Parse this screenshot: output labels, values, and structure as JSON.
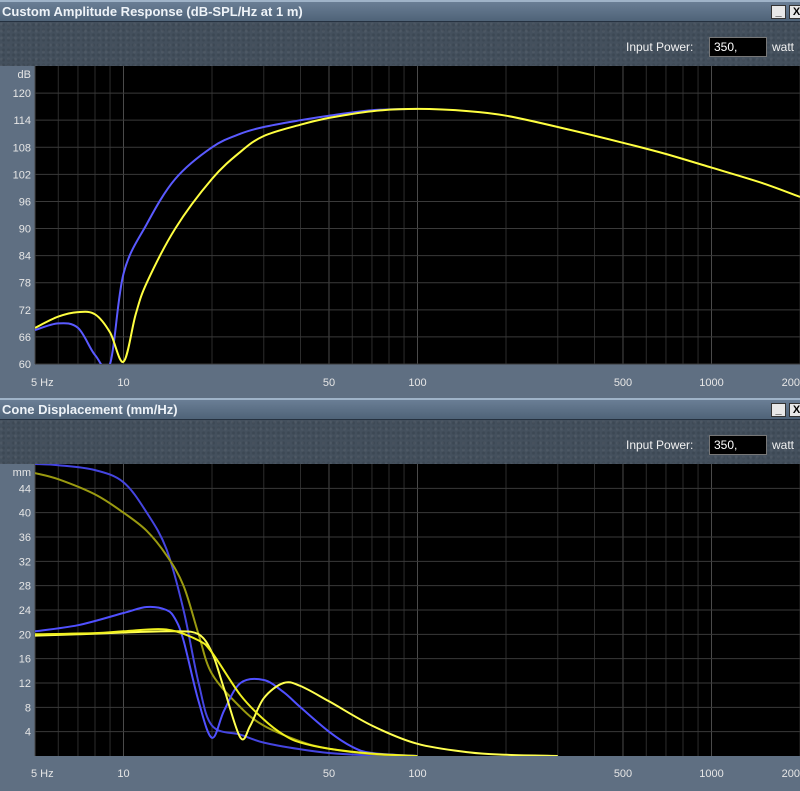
{
  "panels": [
    {
      "title": "Custom Amplitude Response (dB-SPL/Hz at 1 m)",
      "minimize_label": "_",
      "close_label": "X",
      "input_power_label": "Input Power:",
      "input_power_value": "350,",
      "input_power_unit": "watt"
    },
    {
      "title": "Cone Displacement (mm/Hz)",
      "minimize_label": "_",
      "close_label": "X",
      "input_power_label": "Input Power:",
      "input_power_value": "350,",
      "input_power_unit": "watt"
    }
  ],
  "chart_data": [
    {
      "type": "line",
      "title": "Custom Amplitude Response (dB-SPL/Hz at 1 m)",
      "y_unit_label": "dB",
      "x_scale": "log",
      "xlim": [
        5,
        2000
      ],
      "ylim": [
        60,
        126
      ],
      "grid": true,
      "background": "#000000",
      "x_tick_labels": [
        {
          "value": 5,
          "label": "5 Hz"
        },
        {
          "value": 10,
          "label": "10"
        },
        {
          "value": 50,
          "label": "50"
        },
        {
          "value": 100,
          "label": "100"
        },
        {
          "value": 500,
          "label": "500"
        },
        {
          "value": 1000,
          "label": "1000"
        },
        {
          "value": 2000,
          "label": "200"
        }
      ],
      "y_ticks": [
        60,
        66,
        72,
        78,
        84,
        90,
        96,
        102,
        108,
        114,
        120
      ],
      "series": [
        {
          "color": "#5a5aff",
          "x": [
            5,
            6,
            7,
            8,
            9,
            10,
            12,
            15,
            20,
            25,
            30,
            40,
            50,
            70,
            100
          ],
          "y": [
            67.5,
            69,
            68,
            62,
            60,
            80,
            91,
            101,
            108,
            111,
            112.5,
            114,
            115,
            116.2,
            116.5
          ]
        },
        {
          "color": "#ffff40",
          "x": [
            5,
            6,
            7,
            8,
            9,
            10,
            11,
            12,
            15,
            20,
            25,
            30,
            40,
            50,
            70,
            100,
            150,
            200,
            300,
            500,
            700,
            1000,
            1500,
            2000
          ],
          "y": [
            68,
            70.5,
            71.5,
            71,
            67,
            60.5,
            71,
            78,
            90,
            101,
            107,
            110.5,
            113,
            114.5,
            116,
            116.5,
            116,
            115,
            112.5,
            109,
            106.5,
            103.5,
            100,
            97
          ]
        }
      ]
    },
    {
      "type": "line",
      "title": "Cone Displacement (mm/Hz)",
      "y_unit_label": "mm",
      "x_scale": "log",
      "xlim": [
        5,
        2000
      ],
      "ylim": [
        0,
        48
      ],
      "grid": true,
      "background": "#000000",
      "x_tick_labels": [
        {
          "value": 5,
          "label": "5 Hz"
        },
        {
          "value": 10,
          "label": "10"
        },
        {
          "value": 50,
          "label": "50"
        },
        {
          "value": 100,
          "label": "100"
        },
        {
          "value": 500,
          "label": "500"
        },
        {
          "value": 1000,
          "label": "1000"
        },
        {
          "value": 2000,
          "label": "200"
        }
      ],
      "y_ticks": [
        4,
        8,
        12,
        16,
        20,
        24,
        28,
        32,
        36,
        40,
        44
      ],
      "series": [
        {
          "color": "#4545e0",
          "x": [
            5,
            6,
            8,
            10,
            12,
            14,
            16,
            18,
            20,
            25,
            30,
            40,
            50,
            70,
            100
          ],
          "y": [
            48,
            47.8,
            47,
            45,
            40,
            34,
            24,
            12,
            5,
            3.5,
            2.2,
            1.1,
            0.5,
            0.1,
            0
          ]
        },
        {
          "color": "#9a9a10",
          "x": [
            5,
            6,
            8,
            10,
            12,
            14,
            16,
            18,
            20,
            25,
            30,
            40,
            50,
            70,
            100
          ],
          "y": [
            46.5,
            45.5,
            43,
            40,
            37,
            33,
            28,
            20,
            13.5,
            8,
            5,
            2.4,
            1.2,
            0.3,
            0
          ]
        },
        {
          "color": "#5050ff",
          "x": [
            5,
            7,
            10,
            12,
            14,
            15,
            16,
            18,
            20,
            22,
            25,
            30,
            35,
            40,
            50,
            60,
            70,
            100
          ],
          "y": [
            20.5,
            21.5,
            23.5,
            24.5,
            24,
            22.5,
            19,
            9,
            3,
            7.5,
            12,
            12.5,
            10.5,
            8,
            4,
            1.5,
            0.5,
            0
          ]
        },
        {
          "color": "#ffff50",
          "x": [
            5,
            7,
            10,
            15,
            18,
            20,
            22,
            25,
            27,
            30,
            35,
            40,
            50,
            70,
            100,
            150,
            200,
            300
          ],
          "y": [
            19.8,
            20,
            20.3,
            20.5,
            20,
            17,
            11,
            3,
            5,
            9.5,
            12,
            11.5,
            9,
            5,
            2,
            0.6,
            0.2,
            0
          ]
        },
        {
          "color": "#f0f020",
          "x": [
            5,
            8,
            10,
            14,
            18,
            20,
            25,
            30,
            35,
            40,
            50,
            70,
            100
          ],
          "y": [
            20,
            20.2,
            20.5,
            20.8,
            19,
            17,
            10,
            6,
            3.5,
            2.2,
            1.2,
            0.4,
            0
          ]
        }
      ]
    }
  ]
}
